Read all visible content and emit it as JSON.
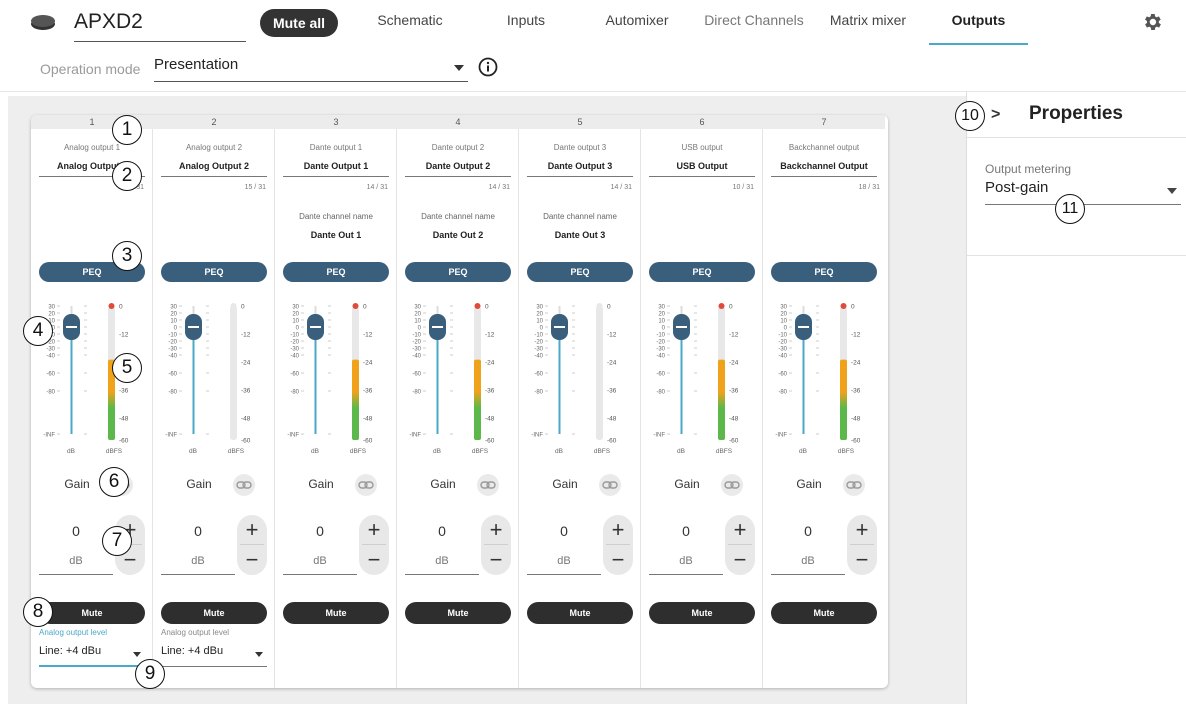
{
  "header": {
    "device_name": "APXD2",
    "mute_all_label": "Mute all",
    "tabs": [
      {
        "label": "Schematic",
        "state": "normal"
      },
      {
        "label": "Inputs",
        "state": "normal"
      },
      {
        "label": "Automixer",
        "state": "normal"
      },
      {
        "label": "Direct Channels",
        "state": "dim"
      },
      {
        "label": "Matrix mixer",
        "state": "normal"
      },
      {
        "label": "Outputs",
        "state": "active"
      }
    ]
  },
  "operation": {
    "label": "Operation mode",
    "value": "Presentation"
  },
  "properties": {
    "chevron": ">",
    "title": "Properties",
    "metering_label": "Output metering",
    "metering_value": "Post-gain"
  },
  "strip_common": {
    "peq_label": "PEQ",
    "gain_label": "Gain",
    "unit_db": "dB",
    "plus": "+",
    "minus": "−",
    "mute_label": "Mute",
    "dante_channel_label": "Dante channel name",
    "fader_scale": [
      "30",
      "20",
      "10",
      "0",
      "-10",
      "-20",
      "-30",
      "-40",
      "-60",
      "-80",
      "-INF"
    ],
    "meter_scale": [
      "0",
      "-12",
      "-24",
      "-36",
      "-48",
      "-60"
    ],
    "fader_unit": "dB",
    "meter_unit": "dBFS"
  },
  "strips": [
    {
      "number": "1",
      "type": "Analog output 1",
      "name": "Analog Output 1",
      "count": "15 / 31",
      "dante_channel": "",
      "gain": "0",
      "meter_level": 0.6,
      "level_label": "Analog output level",
      "level_value": "Line: +4 dBu",
      "level_focus": true
    },
    {
      "number": "2",
      "type": "Analog output 2",
      "name": "Analog Output 2",
      "count": "15 / 31",
      "dante_channel": "",
      "gain": "0",
      "meter_level": 0,
      "level_label": "Analog output level",
      "level_value": "Line: +4 dBu",
      "level_focus": false
    },
    {
      "number": "3",
      "type": "Dante output 1",
      "name": "Dante Output 1",
      "count": "14 / 31",
      "dante_channel": "Dante Out 1",
      "gain": "0",
      "meter_level": 0.6,
      "level_label": "",
      "level_value": "",
      "level_focus": false
    },
    {
      "number": "4",
      "type": "Dante output 2",
      "name": "Dante Output 2",
      "count": "14 / 31",
      "dante_channel": "Dante Out 2",
      "gain": "0",
      "meter_level": 0.6,
      "level_label": "",
      "level_value": "",
      "level_focus": false
    },
    {
      "number": "5",
      "type": "Dante output 3",
      "name": "Dante Output 3",
      "count": "14 / 31",
      "dante_channel": "Dante Out 3",
      "gain": "0",
      "meter_level": 0,
      "level_label": "",
      "level_value": "",
      "level_focus": false
    },
    {
      "number": "6",
      "type": "USB output",
      "name": "USB Output",
      "count": "10 / 31",
      "dante_channel": "",
      "gain": "0",
      "meter_level": 0.6,
      "level_label": "",
      "level_value": "",
      "level_focus": false
    },
    {
      "number": "7",
      "type": "Backchannel output",
      "name": "Backchannel Output",
      "count": "18 / 31",
      "dante_channel": "",
      "gain": "0",
      "meter_level": 0.6,
      "level_label": "",
      "level_value": "",
      "level_focus": false
    }
  ],
  "callouts": [
    "1",
    "2",
    "3",
    "4",
    "5",
    "6",
    "7",
    "8",
    "9",
    "10",
    "11"
  ],
  "colors": {
    "accent": "#4aa8c9",
    "peq": "#3a5f7c",
    "mute": "#2e2e2e",
    "fader_knob": "#3a5f7c",
    "meter_green": "#5cb84a",
    "meter_orange": "#f0a21a",
    "meter_red": "#e04a3a"
  }
}
